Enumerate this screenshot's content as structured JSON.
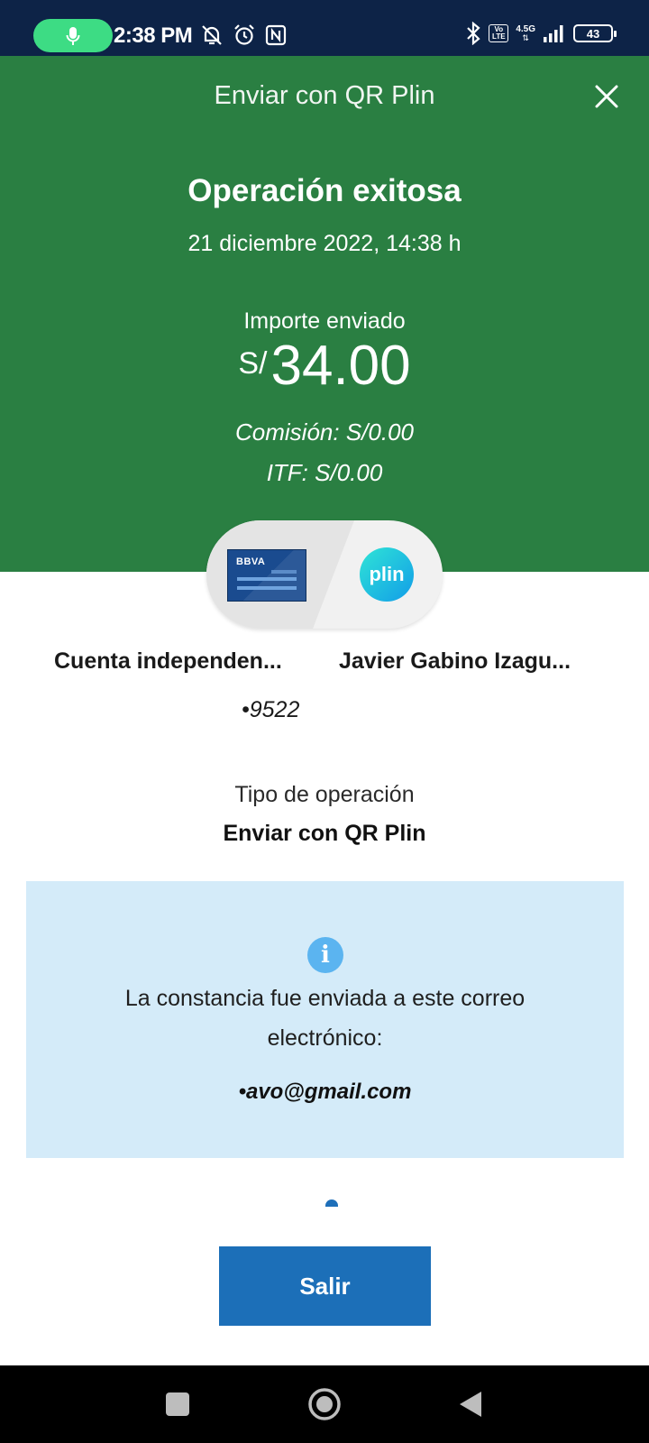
{
  "status_bar": {
    "time": "2:38 PM",
    "network_label_top": "4.5G",
    "volte_label": "Vo LTE",
    "battery": "43",
    "icons": [
      "mic-icon",
      "mute-icon",
      "alarm-icon",
      "nfc-icon",
      "bluetooth-icon",
      "volte-icon",
      "signal-icon",
      "battery-icon"
    ]
  },
  "header": {
    "title": "Enviar con QR Plin",
    "close_icon": "close-icon",
    "success_title": "Operación exitosa",
    "datetime": "21 diciembre 2022, 14:38 h",
    "amount_label": "Importe enviado",
    "currency": "S/",
    "amount": "34.00",
    "commission": "Comisión:  S/0.00",
    "itf": "ITF:  S/0.00",
    "background_color": "#2a7f42"
  },
  "transfer": {
    "bank_logo": "BBVA",
    "wallet_logo": "plin",
    "from_name": "Cuenta independen...",
    "to_name": "Javier Gabino Izagu...",
    "account_number": "•9522"
  },
  "operation": {
    "label": "Tipo de operación",
    "value": "Enviar con QR Plin"
  },
  "info": {
    "icon": "info-icon",
    "message": "La constancia fue enviada a este correo electrónico:",
    "email": "•avo@gmail.com"
  },
  "actions": {
    "exit_label": "Salir",
    "button_color": "#1c6fb8"
  },
  "nav_bar": {
    "icons": [
      "recents-icon",
      "home-icon",
      "back-icon"
    ]
  }
}
